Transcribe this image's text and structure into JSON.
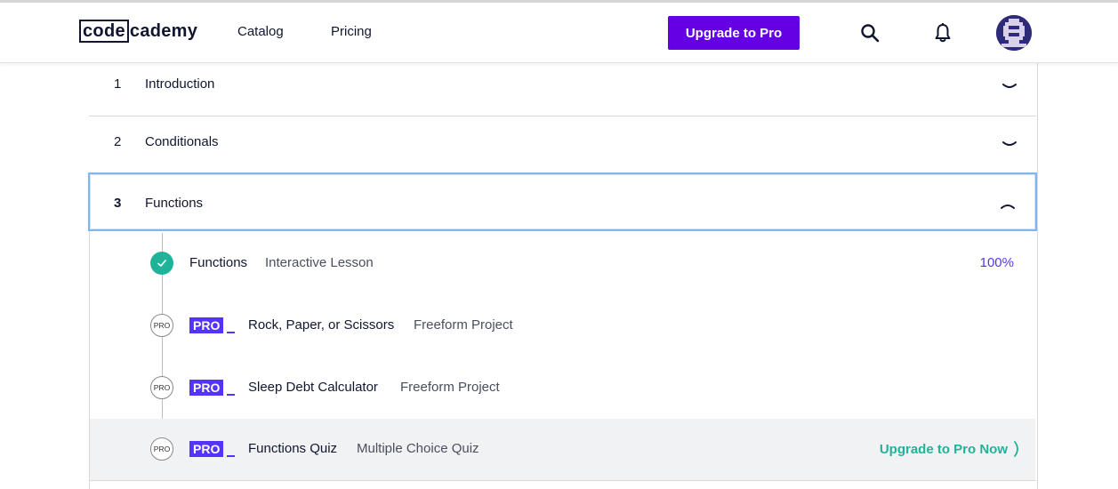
{
  "header": {
    "logo_boxed": "code",
    "logo_rest": "cademy",
    "nav": [
      "Catalog",
      "Pricing"
    ],
    "upgrade_button": "Upgrade to Pro",
    "icons": [
      "search-icon",
      "bell-icon",
      "avatar"
    ]
  },
  "sections": [
    {
      "number": "1",
      "title": "Introduction",
      "state": "collapsed"
    },
    {
      "number": "2",
      "title": "Conditionals",
      "state": "collapsed"
    },
    {
      "number": "3",
      "title": "Functions",
      "state": "expanded"
    }
  ],
  "lessons": [
    {
      "name": "Functions",
      "type": "Interactive Lesson",
      "status": "complete",
      "progress": "100%"
    },
    {
      "name": "Rock, Paper, or Scissors",
      "type": "Freeform Project",
      "status": "pro",
      "pro_badge": "PRO",
      "pro_circle": "PRO"
    },
    {
      "name": "Sleep Debt Calculator",
      "type": "Freeform Project",
      "status": "pro",
      "pro_badge": "PRO",
      "pro_circle": "PRO"
    },
    {
      "name": "Functions Quiz",
      "type": "Multiple Choice Quiz",
      "status": "pro",
      "pro_badge": "PRO",
      "pro_circle": "PRO",
      "cta": "Upgrade to Pro Now"
    }
  ],
  "colors": {
    "brand_purple": "#6400e4",
    "pro_badge": "#5533ff",
    "success_teal": "#1fb39a",
    "text_dark": "#10162f",
    "focus_outline": "#7fb6ef"
  }
}
